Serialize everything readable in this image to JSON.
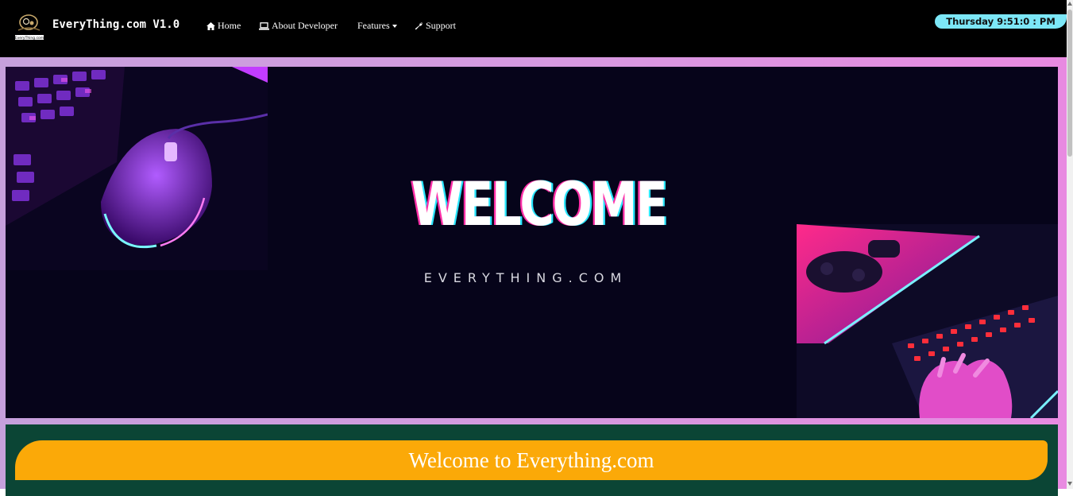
{
  "navbar": {
    "brand_logo_text": "EveryThing.com",
    "brand_title": "EveryThing.com V1.0",
    "items": [
      {
        "label": "Home",
        "icon": "home-icon"
      },
      {
        "label": "About Developer",
        "icon": "laptop-icon"
      },
      {
        "label": "Features",
        "icon": "caret-down-icon"
      },
      {
        "label": "Support",
        "icon": "wrench-icon"
      }
    ],
    "clock": "Thursday 9:51:0 : PM"
  },
  "banner": {
    "headline": "WELCOME",
    "subtitle": "EVERYTHING.COM"
  },
  "welcome_panel": {
    "heading": "Welcome to Everything.com"
  },
  "colors": {
    "navbar_bg": "#000000",
    "clock_bg": "#7ce7f7",
    "banner_bg": "#06041a",
    "panel_bg": "#0b4535",
    "pill_bg": "#fba908",
    "gradient_start": "#c6a0dc",
    "gradient_end": "#e88ae1"
  }
}
